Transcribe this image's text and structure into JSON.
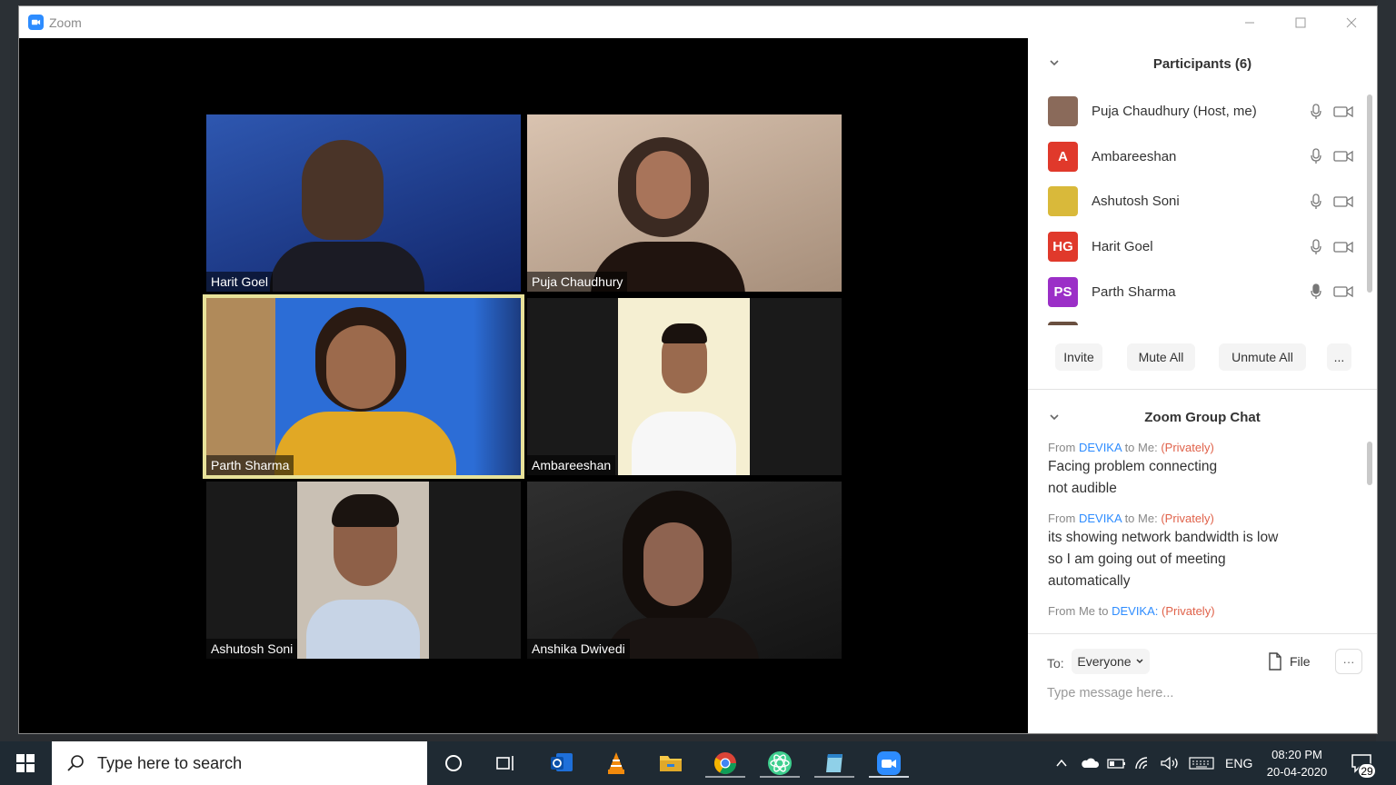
{
  "window": {
    "title": "Zoom"
  },
  "tiles": [
    {
      "name": "Harit Goel",
      "bg": "#1e3a8a"
    },
    {
      "name": "Puja Chaudhury",
      "bg": "#c9b8a6"
    },
    {
      "name": "Parth Sharma",
      "bg": "#2c6dd6",
      "active": true
    },
    {
      "name": "Ambareeshan",
      "bg": "#f2ecd0"
    },
    {
      "name": "Ashutosh Soni",
      "bg": "#b9b0a6"
    },
    {
      "name": "Anshika Dwivedi",
      "bg": "#2a2a2a"
    }
  ],
  "participants": {
    "header": "Participants (6)",
    "items": [
      {
        "name": "Puja Chaudhury (Host, me)",
        "initials": "",
        "color": "#8a6a5a"
      },
      {
        "name": "Ambareeshan",
        "initials": "A",
        "color": "#e0392b"
      },
      {
        "name": "Ashutosh Soni",
        "initials": "",
        "color": "#d9b93a"
      },
      {
        "name": "Harit Goel",
        "initials": "HG",
        "color": "#e0392b"
      },
      {
        "name": "Parth Sharma",
        "initials": "PS",
        "color": "#9b2fc7"
      }
    ],
    "buttons": {
      "invite": "Invite",
      "mute_all": "Mute All",
      "unmute_all": "Unmute All",
      "more": "..."
    }
  },
  "chat": {
    "header": "Zoom Group Chat",
    "messages": [
      {
        "from": "From",
        "sender": "DEVIKA",
        "to": "to Me:",
        "privately": "(Privately)",
        "lines": [
          "Facing problem connecting",
          "not audible"
        ]
      },
      {
        "from": "From",
        "sender": "DEVIKA",
        "to": "to Me:",
        "privately": "(Privately)",
        "lines": [
          "its showing network bandwidth is low",
          "so I am going out of meeting",
          "automatically"
        ]
      },
      {
        "from": "From Me to",
        "sender": "DEVIKA:",
        "to": "",
        "privately": "(Privately)",
        "lines": []
      }
    ],
    "to_label": "To:",
    "to_value": "Everyone",
    "file_label": "File",
    "more_label": "···",
    "input_placeholder": "Type message here..."
  },
  "taskbar": {
    "search_placeholder": "Type here to search",
    "lang": "ENG",
    "time": "08:20 PM",
    "date": "20-04-2020",
    "notifications": "29"
  }
}
